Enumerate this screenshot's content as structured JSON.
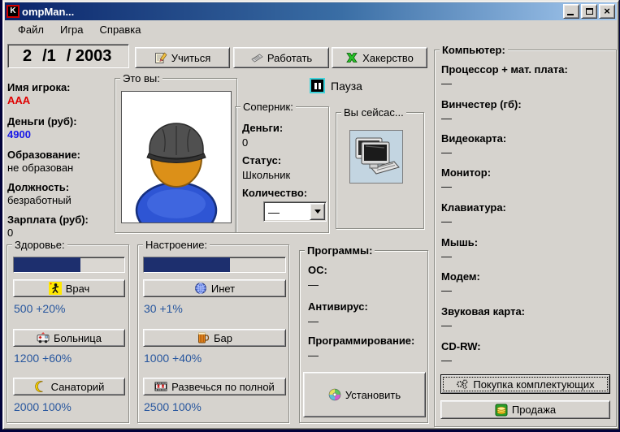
{
  "window": {
    "title": "ompMan...",
    "icon_text": "K"
  },
  "menu": {
    "items": [
      "Файл",
      "Игра",
      "Справка"
    ]
  },
  "toolbar": {
    "date": {
      "day": "2",
      "month": "/1",
      "year": "/ 2003"
    },
    "study": "Учиться",
    "work": "Работать",
    "hack": "Хакерство",
    "pause": "Пауза"
  },
  "player": {
    "name_label": "Имя игрока:",
    "name": "AAA",
    "money_label": "Деньги (руб):",
    "money": "4900",
    "education_label": "Образование:",
    "education": "не образован",
    "job_label": "Должность:",
    "job": "безработный",
    "salary_label": "Зарплата (руб):",
    "salary": "0"
  },
  "you_box": {
    "legend": "Это вы:"
  },
  "opponent": {
    "legend": "Соперник:",
    "money_label": "Деньги:",
    "money": "0",
    "status_label": "Статус:",
    "status": "Школьник",
    "count_label": "Количество:",
    "count": "—"
  },
  "now_box": {
    "legend": "Вы сейсас..."
  },
  "computer": {
    "legend": "Компьютер:",
    "items": [
      {
        "label": "Процессор + мат. плата:",
        "value": "—"
      },
      {
        "label": "Винчестер (гб):",
        "value": "—"
      },
      {
        "label": "Видеокарта:",
        "value": "—"
      },
      {
        "label": "Монитор:",
        "value": "—"
      },
      {
        "label": "Клавиатура:",
        "value": "—"
      },
      {
        "label": "Мышь:",
        "value": "—"
      },
      {
        "label": "Модем:",
        "value": "—"
      },
      {
        "label": "Звуковая карта:",
        "value": "—"
      },
      {
        "label": "CD-RW:",
        "value": "—"
      }
    ],
    "buy": "Покупка комплектующих",
    "sell": "Продажа"
  },
  "health": {
    "legend": "Здоровье:",
    "percent": 60,
    "doctor": "Врач",
    "doctor_cost": "500 +20%",
    "hospital": "Больница",
    "hospital_cost": "1200 +60%",
    "resort": "Санаторий",
    "resort_cost": "2000 100%"
  },
  "mood": {
    "legend": "Настроение:",
    "percent": 61,
    "inet": "Инет",
    "inet_cost": "30 +1%",
    "bar": "Бар",
    "bar_cost": "1000 +40%",
    "party": "Развечься по полной",
    "party_cost": "2500 100%"
  },
  "programs": {
    "legend": "Программы:",
    "os_label": "ОС:",
    "os": "—",
    "antivirus_label": "Антивирус:",
    "antivirus": "—",
    "programming_label": "Программирование:",
    "programming": "—",
    "install": "Установить"
  },
  "colors": {
    "player_name": "#e00000",
    "player_money": "#1818e8",
    "cost_text": "#27569e",
    "progress_fill": "#1d2f6e",
    "titlebar_start": "#0a246a",
    "titlebar_end": "#a6caf0",
    "pause_border": "#3fd2da",
    "window_bg": "#d6d3ce"
  }
}
